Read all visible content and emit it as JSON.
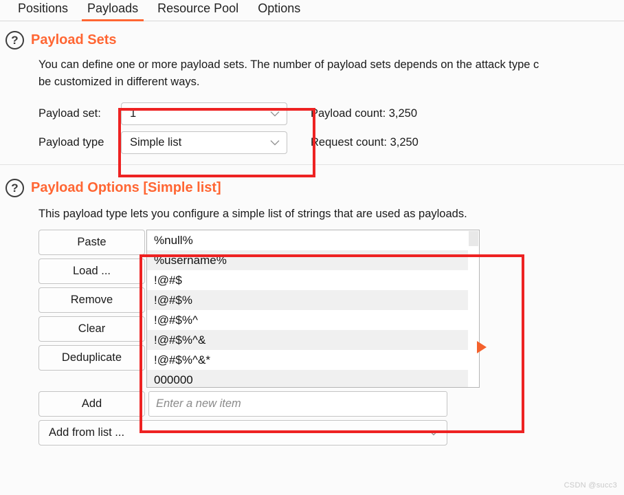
{
  "accent": "#ff6633",
  "annotation_color": "#ee2222",
  "tabs": [
    {
      "label": "Positions",
      "active": false
    },
    {
      "label": "Payloads",
      "active": true
    },
    {
      "label": "Resource Pool",
      "active": false
    },
    {
      "label": "Options",
      "active": false
    }
  ],
  "payload_sets": {
    "help_icon": "question-circle-icon",
    "title": "Payload Sets",
    "description": "You can define one or more payload sets. The number of payload sets depends on the attack type c",
    "description_line2": "be customized in different ways.",
    "payload_set_label": "Payload set:",
    "payload_set_value": "1",
    "payload_type_label": "Payload type",
    "payload_type_value": "Simple list",
    "payload_count": "Payload count: 3,250",
    "request_count": "Request count: 3,250"
  },
  "payload_options": {
    "help_icon": "question-circle-icon",
    "title": "Payload Options [Simple list]",
    "description": "This payload type lets you configure a simple list of strings that are used as payloads.",
    "buttons": [
      "Paste",
      "Load ...",
      "Remove",
      "Clear",
      "Deduplicate"
    ],
    "list_items": [
      "%null%",
      "%username%",
      "!@#$",
      "!@#$%",
      "!@#$%^",
      "!@#$%^&",
      "!@#$%^&*",
      "000000"
    ],
    "add_button": "Add",
    "new_item_placeholder": "Enter a new item",
    "new_item_value": "",
    "add_from_list_label": "Add from list ..."
  },
  "watermark": "CSDN @succ3"
}
